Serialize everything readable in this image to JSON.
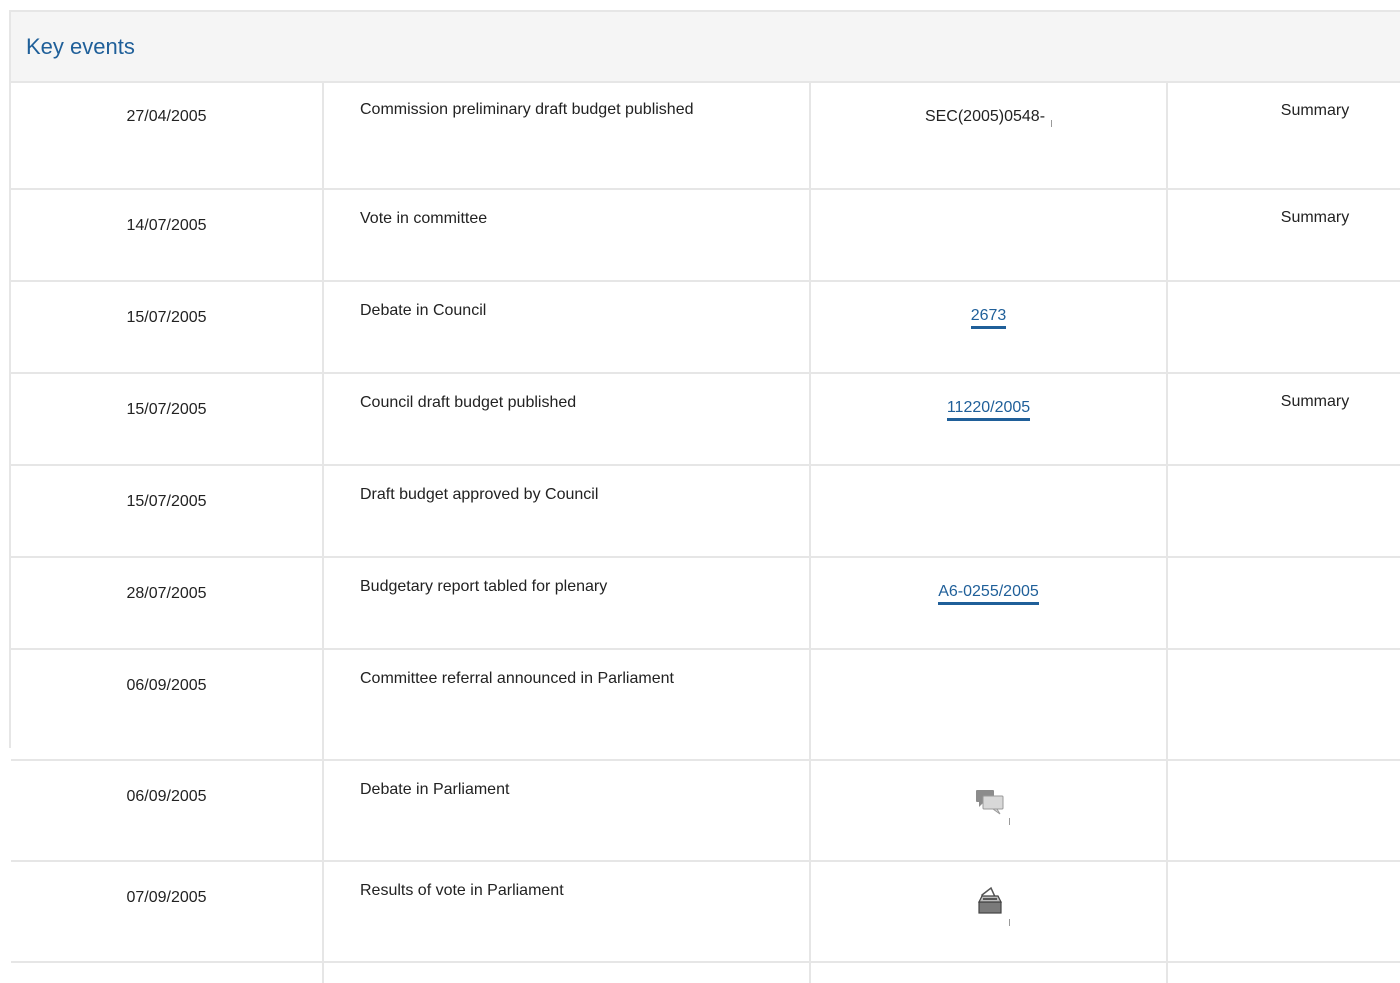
{
  "section_title": "Key events",
  "rows": [
    {
      "date": "27/04/2005",
      "event": "Commission preliminary draft budget published",
      "doc": "SEC(2005)0548-",
      "summary": "Summary"
    },
    {
      "date": "14/07/2005",
      "event": "Vote in committee",
      "doc": "",
      "summary": "Summary"
    },
    {
      "date": "15/07/2005",
      "event": "Debate in Council",
      "doc": "2673",
      "summary": ""
    },
    {
      "date": "15/07/2005",
      "event": "Council draft budget published",
      "doc": "11220/2005",
      "summary": "Summary"
    },
    {
      "date": "15/07/2005",
      "event": "Draft budget approved by Council",
      "doc": "",
      "summary": ""
    },
    {
      "date": "28/07/2005",
      "event": "Budgetary report tabled for plenary",
      "doc": "A6-0255/2005",
      "summary": ""
    },
    {
      "date": "06/09/2005",
      "event": "Committee referral announced in Parliament",
      "doc": "",
      "summary": ""
    },
    {
      "date": "06/09/2005",
      "event": "Debate in Parliament",
      "doc_icon": "debate-speech-bubbles-icon",
      "summary": ""
    },
    {
      "date": "07/09/2005",
      "event": "Results of vote in Parliament",
      "doc_icon": "ballot-box-icon",
      "summary": ""
    }
  ],
  "colors": {
    "link": "#1f5f99",
    "border": "#e6e6e6",
    "header_bg": "#f5f5f5"
  }
}
